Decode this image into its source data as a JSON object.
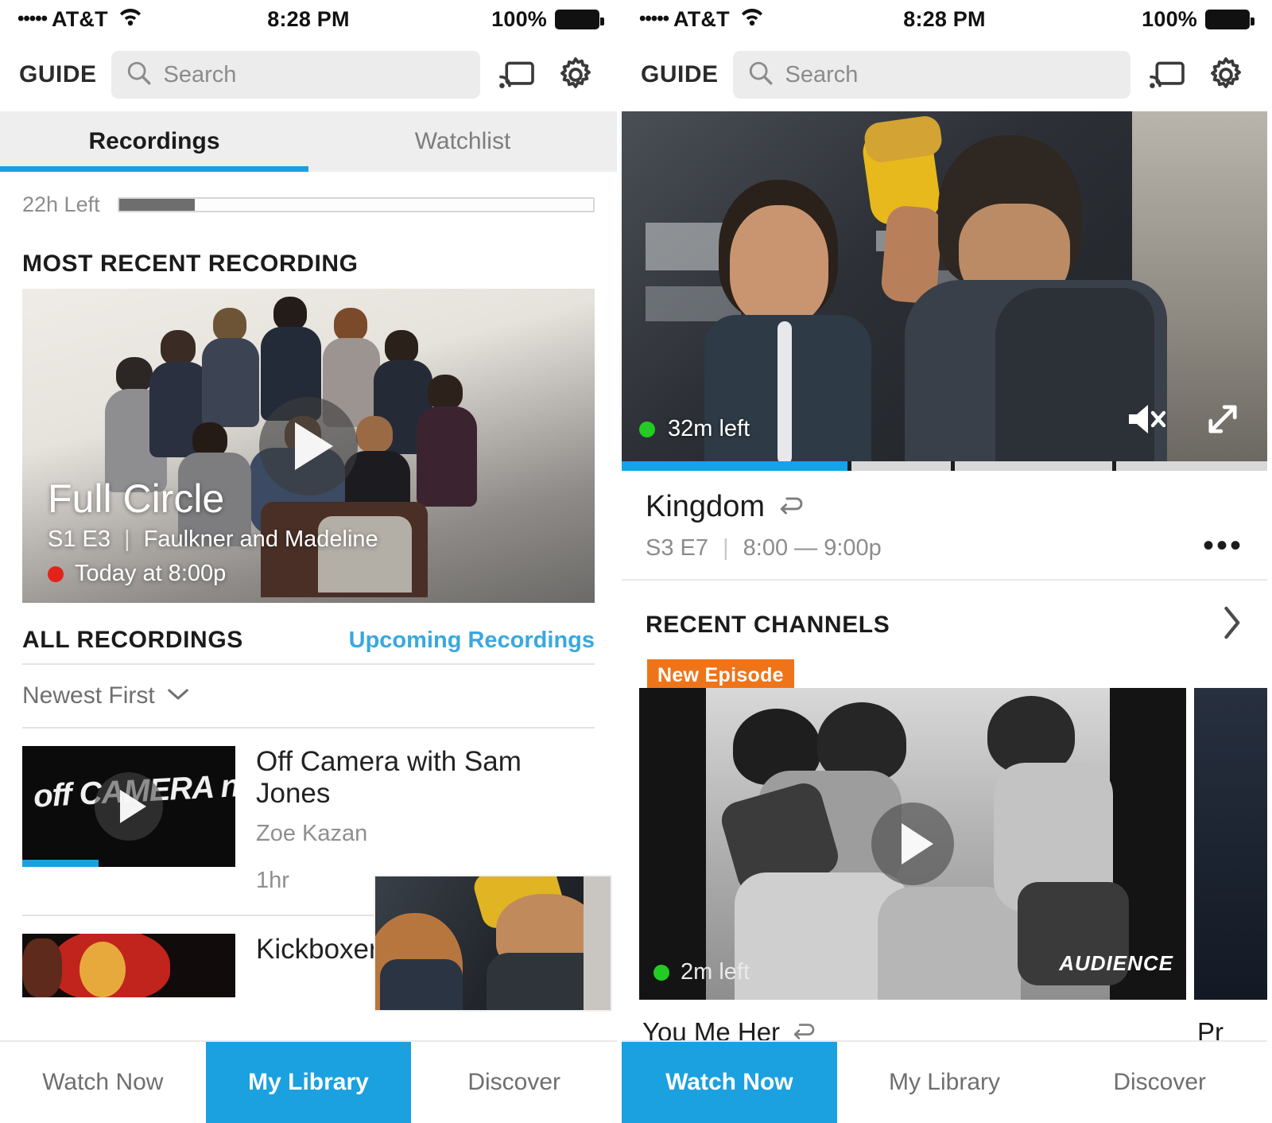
{
  "status_bar": {
    "signal_dots": "•••••",
    "carrier": "AT&T",
    "time": "8:28 PM",
    "battery_percent": "100%"
  },
  "header": {
    "guide_label": "GUIDE",
    "search_placeholder": "Search",
    "cast_icon": "cast-icon",
    "settings_icon": "gear-icon"
  },
  "left_screen": {
    "tabs": [
      {
        "label": "Recordings",
        "active": true
      },
      {
        "label": "Watchlist",
        "active": false
      }
    ],
    "storage": {
      "label": "22h Left",
      "fill_percent": 16
    },
    "most_recent_heading": "MOST RECENT RECORDING",
    "hero": {
      "title": "Full Circle",
      "episode": "S1 E3",
      "separator": "|",
      "episode_title": "Faulkner and Madeline",
      "airtime": "Today at 8:00p",
      "recording_dot_color": "#e32219",
      "play_icon": "play-icon"
    },
    "all_recordings_heading": "ALL RECORDINGS",
    "upcoming_link": "Upcoming Recordings",
    "sort": {
      "label": "Newest First",
      "chevron_icon": "chevron-down-icon"
    },
    "recordings": [
      {
        "title": "Off Camera with Sam Jones",
        "person": "Zoe Kazan",
        "duration": "1hr",
        "progress_percent": 36,
        "thumb_text": "off CAMERA no."
      },
      {
        "title": "Kickboxer",
        "person": "",
        "duration": "",
        "progress_percent": 0,
        "thumb_text": ""
      }
    ]
  },
  "right_screen": {
    "player": {
      "time_left": "32m left",
      "live_dot_color": "#22cc22",
      "mute_icon": "speaker-mute-icon",
      "fullscreen_icon": "expand-icon",
      "seek_percent": 35
    },
    "now_playing": {
      "title": "Kingdom",
      "series_icon": "series-loop-icon",
      "episode": "S3 E7",
      "separator": "|",
      "timeslot": "8:00 — 9:00p",
      "more_icon": "more-dots-icon"
    },
    "recent_channels": {
      "heading": "RECENT CHANNELS",
      "chevron_icon": "chevron-right-icon",
      "cards": [
        {
          "badge": "New Episode",
          "time_left": "2m left",
          "caption": "You Me Her",
          "series_icon": "series-loop-icon",
          "network": "AUDIENCE",
          "play_icon": "play-icon"
        },
        {
          "badge": "",
          "time_left": "",
          "caption": "Pr",
          "series_icon": "",
          "network": "",
          "play_icon": ""
        }
      ]
    }
  },
  "bottom_nav": {
    "left": [
      {
        "label": "Watch Now",
        "active": false
      },
      {
        "label": "My Library",
        "active": true
      },
      {
        "label": "Discover",
        "active": false
      }
    ],
    "right": [
      {
        "label": "Watch Now",
        "active": true
      },
      {
        "label": "My Library",
        "active": false
      },
      {
        "label": "Discover",
        "active": false
      }
    ]
  },
  "colors": {
    "accent_blue": "#1ba0e0",
    "badge_orange": "#ef7419",
    "record_red": "#e32219",
    "live_green": "#22cc22"
  }
}
